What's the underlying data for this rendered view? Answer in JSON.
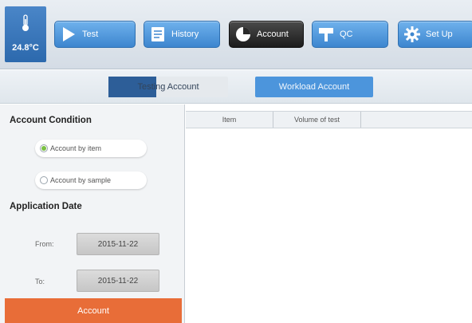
{
  "status": {
    "temperature": "24.8°C",
    "icon": "thermometer-icon"
  },
  "nav": {
    "items": [
      {
        "label": "Test",
        "icon": "play-icon"
      },
      {
        "label": "History",
        "icon": "history-icon"
      },
      {
        "label": "Account",
        "icon": "account-icon",
        "active": true
      },
      {
        "label": "QC",
        "icon": "qc-icon"
      },
      {
        "label": "Set Up",
        "icon": "gear-icon"
      }
    ]
  },
  "subtabs": {
    "testing": "Testing Account",
    "workload": "Workload Account"
  },
  "left_panel": {
    "condition_title": "Account Condition",
    "radios": [
      {
        "label": "Account by item",
        "selected": true
      },
      {
        "label": "Account by sample",
        "selected": false
      }
    ],
    "date_title": "Application Date",
    "from_label": "From:",
    "from_value": "2015-11-22",
    "to_label": "To:",
    "to_value": "2015-11-22",
    "account_button": "Account"
  },
  "table": {
    "columns": [
      "Item",
      "Volume of test"
    ]
  },
  "colors": {
    "nav_blue": "#4a90d9",
    "nav_active": "#2a2a2a",
    "subtab_dark": "#2d5e98",
    "subtab_light": "#4c95dc",
    "account_button": "#e86d38",
    "radio_selected": "#7bc043"
  }
}
